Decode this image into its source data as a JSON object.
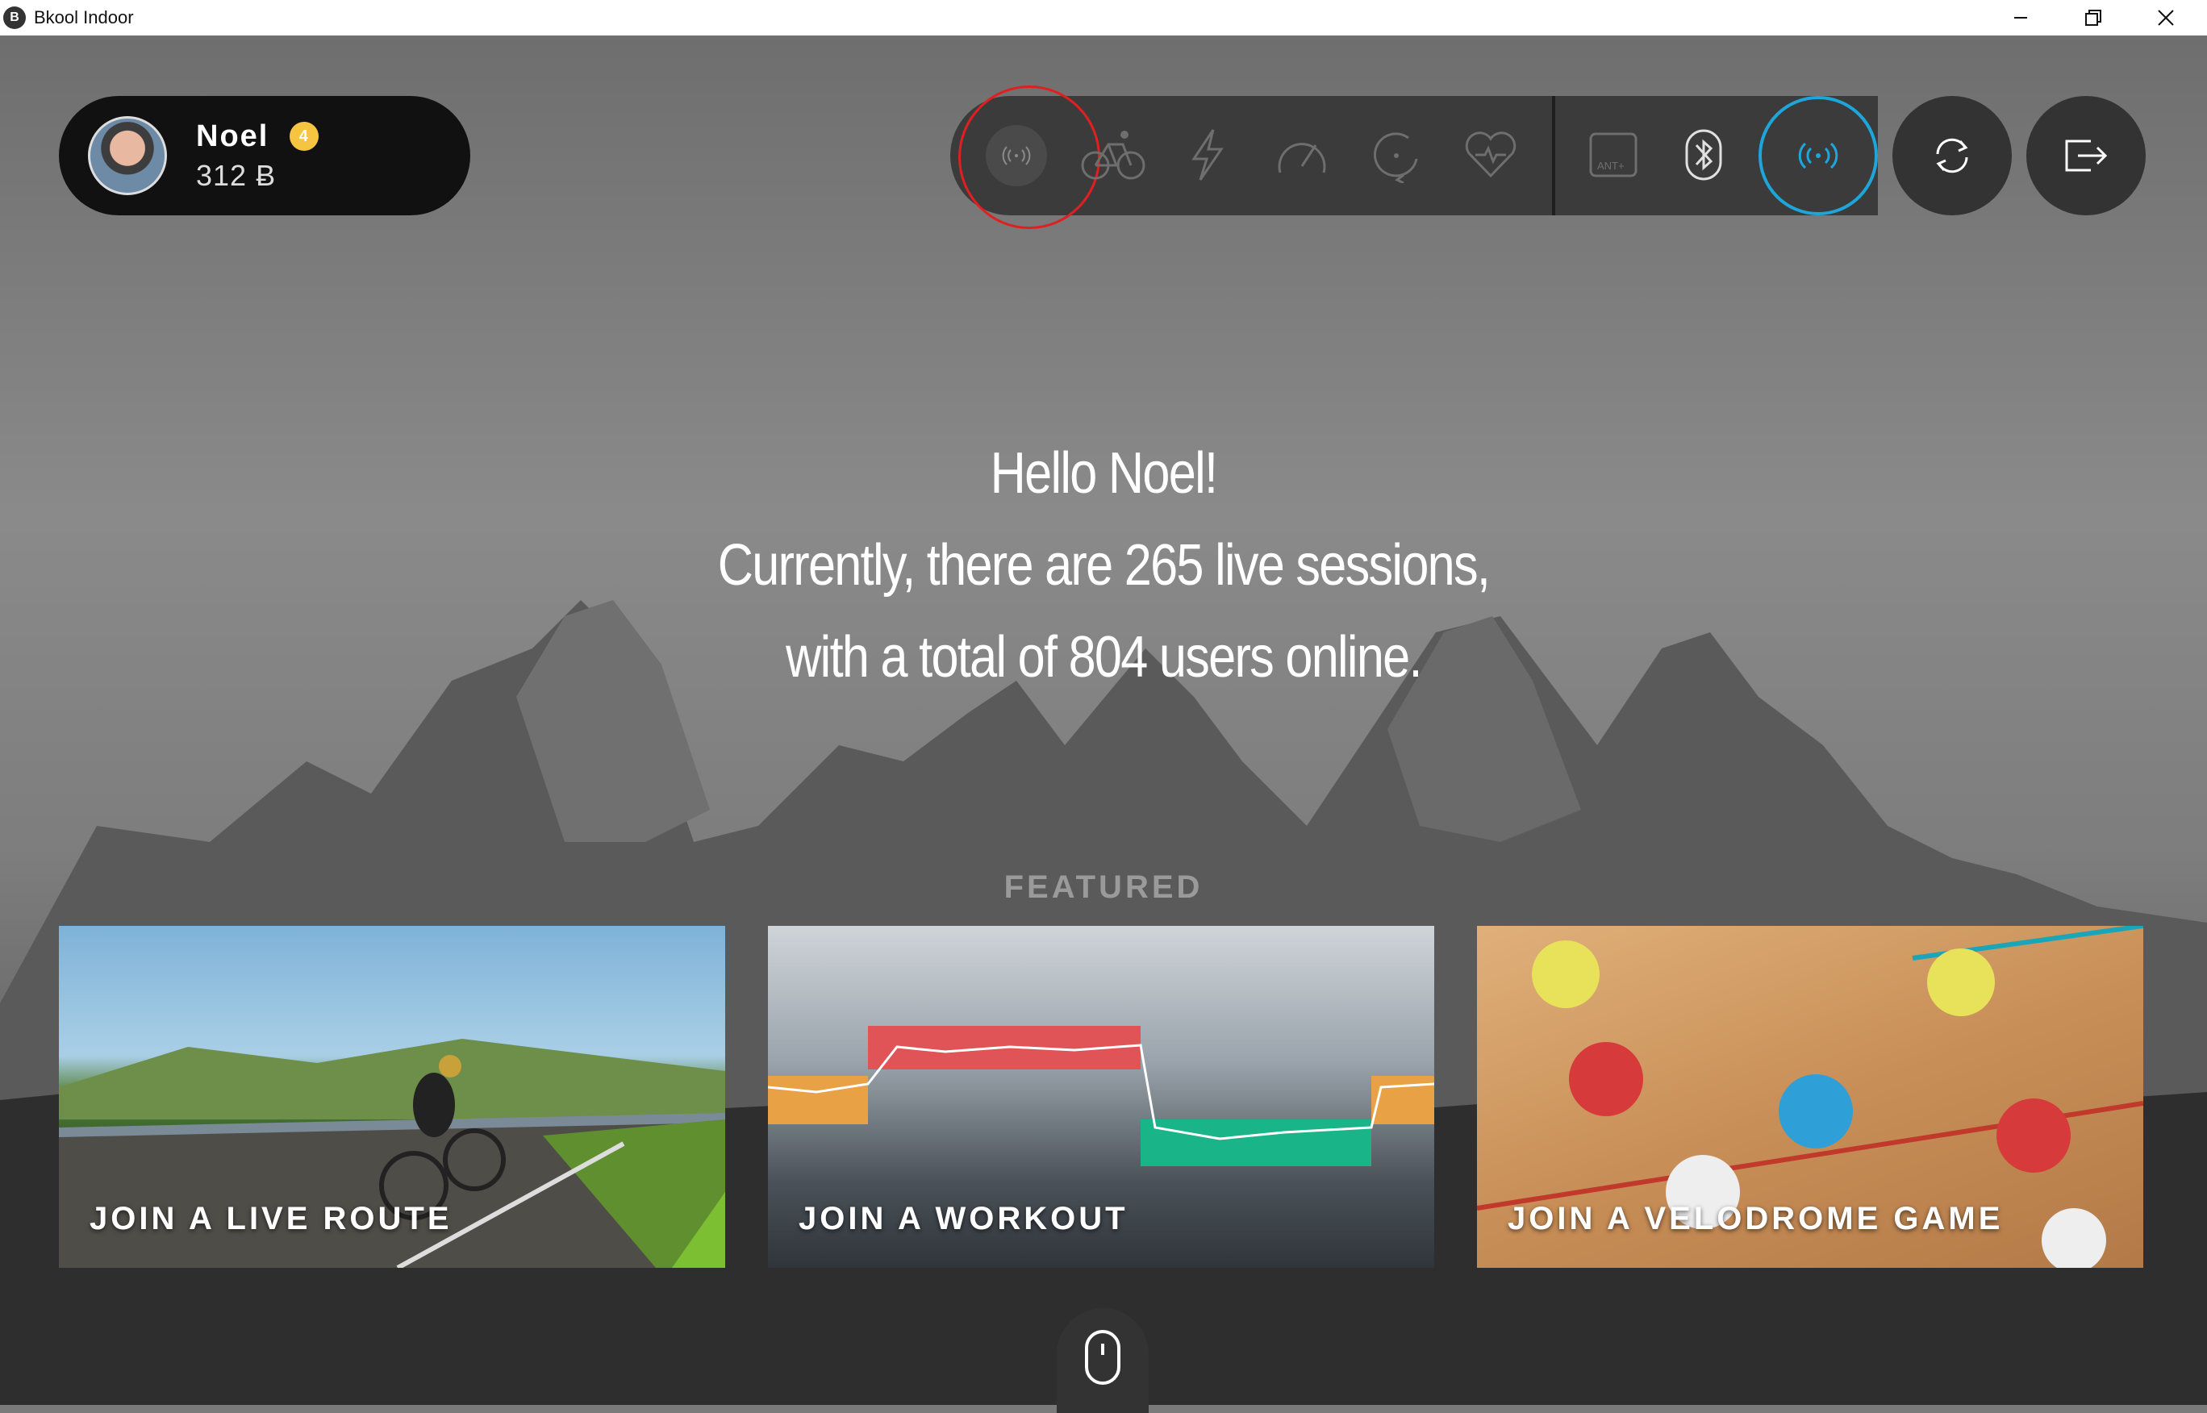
{
  "window": {
    "title": "Bkool Indoor",
    "app_icon_letter": "B"
  },
  "user": {
    "name": "Noel",
    "level": "4",
    "points": "312 Ƀ"
  },
  "toolbar": {
    "icons": [
      "scan-icon",
      "bike-icon",
      "power-icon",
      "speed-icon",
      "cadence-icon",
      "heart-rate-icon",
      "ant-plus-icon",
      "bluetooth-icon",
      "broadcast-icon",
      "sync-icon",
      "logout-icon"
    ],
    "active_color": "#1ea5d9",
    "highlight_color": "#e02020"
  },
  "greeting": {
    "line1": "Hello Noel!",
    "line2": "Currently, there are 265 live sessions,",
    "line3": "with a total of 804 users online."
  },
  "featured": {
    "heading": "FEATURED",
    "cards": [
      {
        "label": "JOIN A LIVE ROUTE"
      },
      {
        "label": "JOIN A WORKOUT"
      },
      {
        "label": "JOIN A VELODROME GAME"
      }
    ]
  }
}
